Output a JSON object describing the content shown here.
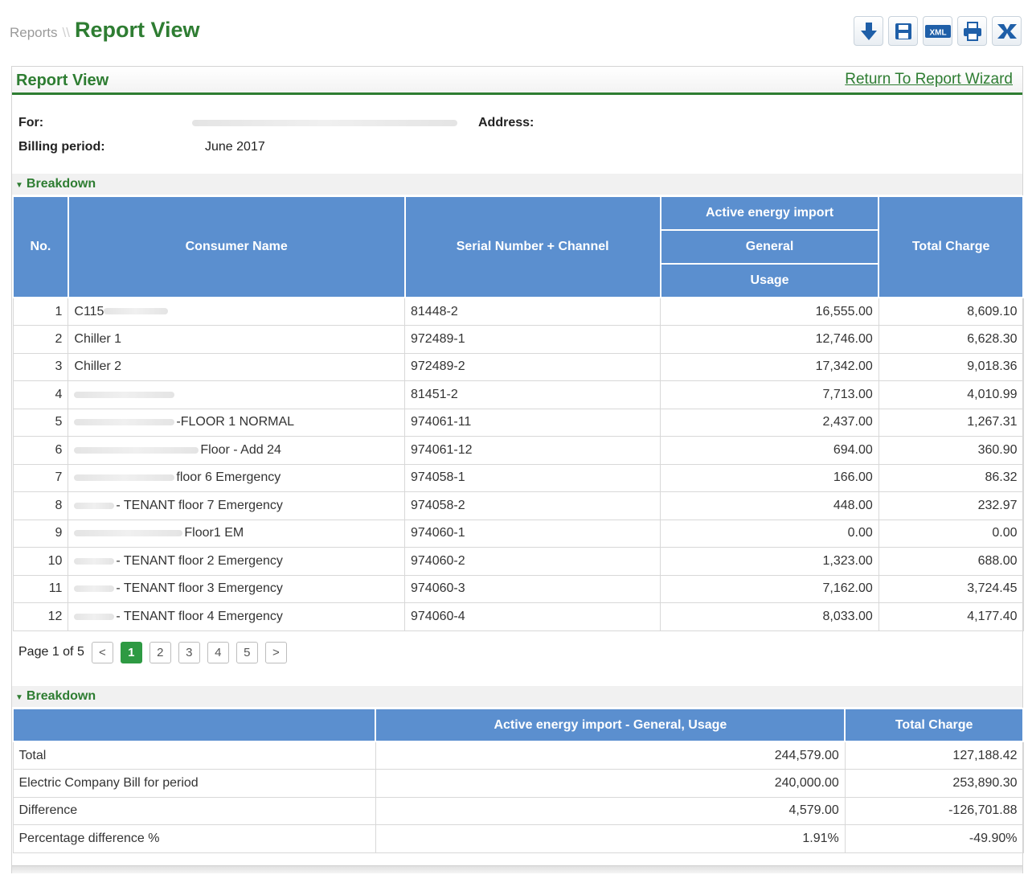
{
  "header": {
    "breadcrumb": "Reports",
    "separator": "\\\\",
    "title": "Report View"
  },
  "toolbar": {
    "buttons": [
      {
        "name": "download-icon"
      },
      {
        "name": "save-icon"
      },
      {
        "name": "xml-icon",
        "label": "XML"
      },
      {
        "name": "print-icon"
      },
      {
        "name": "excel-icon"
      }
    ]
  },
  "panel": {
    "title": "Report View",
    "return_link": "Return To Report Wizard"
  },
  "info": {
    "for_label": "For:",
    "address_label": "Address:",
    "billing_label": "Billing period:",
    "billing_value": "June 2017"
  },
  "breakdown": {
    "section_title": "Breakdown",
    "headers": {
      "no": "No.",
      "consumer": "Consumer Name",
      "serial": "Serial Number + Channel",
      "energy": "Active energy import",
      "general": "General",
      "usage": "Usage",
      "total": "Total Charge"
    },
    "rows": [
      {
        "no": "1",
        "name": "C115",
        "serial": "81448-2",
        "usage": "16,555.00",
        "charge": "8,609.10"
      },
      {
        "no": "2",
        "name": "Chiller 1",
        "serial": "972489-1",
        "usage": "12,746.00",
        "charge": "6,628.30"
      },
      {
        "no": "3",
        "name": "Chiller 2",
        "serial": "972489-2",
        "usage": "17,342.00",
        "charge": "9,018.36"
      },
      {
        "no": "4",
        "name": "",
        "serial": "81451-2",
        "usage": "7,713.00",
        "charge": "4,010.99"
      },
      {
        "no": "5",
        "name": "-FLOOR 1 NORMAL",
        "serial": "974061-11",
        "usage": "2,437.00",
        "charge": "1,267.31"
      },
      {
        "no": "6",
        "name": "Floor - Add 24",
        "serial": "974061-12",
        "usage": "694.00",
        "charge": "360.90"
      },
      {
        "no": "7",
        "name": "floor 6 Emergency",
        "serial": "974058-1",
        "usage": "166.00",
        "charge": "86.32"
      },
      {
        "no": "8",
        "name": "- TENANT floor 7 Emergency",
        "serial": "974058-2",
        "usage": "448.00",
        "charge": "232.97"
      },
      {
        "no": "9",
        "name": "Floor1 EM",
        "serial": "974060-1",
        "usage": "0.00",
        "charge": "0.00"
      },
      {
        "no": "10",
        "name": "- TENANT floor 2 Emergency",
        "serial": "974060-2",
        "usage": "1,323.00",
        "charge": "688.00"
      },
      {
        "no": "11",
        "name": "- TENANT floor 3 Emergency",
        "serial": "974060-3",
        "usage": "7,162.00",
        "charge": "3,724.45"
      },
      {
        "no": "12",
        "name": "- TENANT floor 4 Emergency",
        "serial": "974060-4",
        "usage": "8,033.00",
        "charge": "4,177.40"
      }
    ]
  },
  "pagination": {
    "label": "Page 1 of 5",
    "prev": "<",
    "next": ">",
    "pages": [
      "1",
      "2",
      "3",
      "4",
      "5"
    ],
    "current": "1"
  },
  "summary": {
    "section_title": "Breakdown",
    "headers": {
      "energy": "Active energy import - General, Usage",
      "total": "Total Charge"
    },
    "rows": [
      {
        "label": "Total",
        "usage": "244,579.00",
        "charge": "127,188.42"
      },
      {
        "label": "Electric Company Bill for period",
        "usage": "240,000.00",
        "charge": "253,890.30"
      },
      {
        "label": "Difference",
        "usage": "4,579.00",
        "charge": "-126,701.88"
      },
      {
        "label": "Percentage difference %",
        "usage": "1.91%",
        "charge": "-49.90%"
      }
    ]
  },
  "colors": {
    "accent_green": "#2e7d32",
    "table_header_blue": "#5b8fcf",
    "active_page_green": "#2e9a43"
  }
}
